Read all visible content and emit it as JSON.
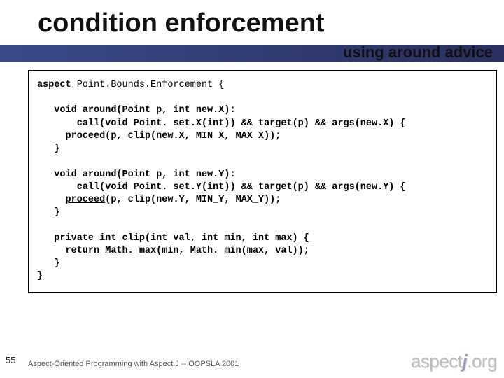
{
  "header": {
    "title": "condition enforcement",
    "subtitle": "using around advice"
  },
  "code": {
    "aspect_kw": "aspect",
    "aspect_decl": " Point.Bounds.Enforcement {",
    "adviceX": {
      "sig_pre": "   void around(Point p, int new.X):",
      "pc_kw1": "call",
      "pc_mid1": "(void Point. set.X(int)) && ",
      "pc_kw2": "target",
      "pc_mid2": "(p) && ",
      "pc_kw3": "args",
      "pc_tail": "(new.X) {",
      "proceed_kw": "proceed",
      "proceed_args": "(p, clip(new.X, MIN_X, MAX_X));",
      "close": "   }"
    },
    "adviceY": {
      "sig_pre": "   void around(Point p, int new.Y):",
      "pc_kw1": "call",
      "pc_mid1": "(void Point. set.Y(int)) && ",
      "pc_kw2": "target",
      "pc_mid2": "(p) && ",
      "pc_kw3": "args",
      "pc_tail": "(new.Y) {",
      "proceed_kw": "proceed",
      "proceed_args": "(p, clip(new.Y, MIN_Y, MAX_Y));",
      "close": "   }"
    },
    "clip": {
      "sig": "   private int clip(int val, int min, int max) {",
      "body": "     return Math. max(min, Math. min(max, val));",
      "close": "   }"
    },
    "end": "}"
  },
  "footer": {
    "page": "55",
    "credit": "Aspect-Oriented Programming with Aspect.J -- OOPSLA 2001",
    "brand_a": "aspect",
    "brand_j": "j",
    "brand_dot": ".org"
  }
}
